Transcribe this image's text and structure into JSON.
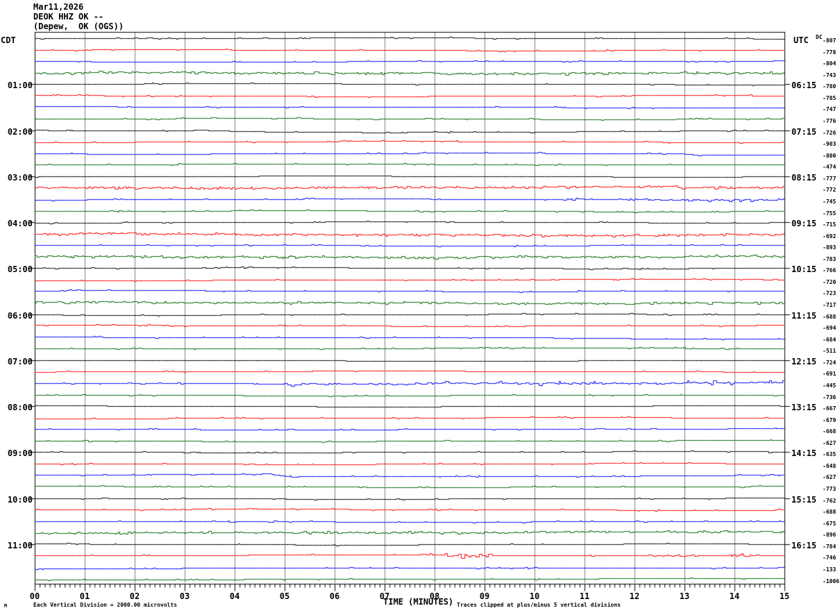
{
  "header": {
    "date": "Mar11,2026",
    "station": "DEOK HHZ OK --",
    "location": "(Depew,  OK (OGS))"
  },
  "axis": {
    "left_header": "CDT",
    "right_header": "UTC",
    "dc_header": "DC",
    "x_title": "TIME (MINUTES)",
    "x_tick_labels": [
      "00",
      "01",
      "02",
      "03",
      "04",
      "05",
      "06",
      "07",
      "08",
      "09",
      "10",
      "11",
      "12",
      "13",
      "14",
      "15"
    ],
    "left_hour_labels": [
      "01:00",
      "02:00",
      "03:00",
      "04:00",
      "05:00",
      "06:00",
      "07:00",
      "08:00",
      "09:00",
      "10:00",
      "11:00"
    ],
    "right_hour_labels": [
      "06:15",
      "07:15",
      "08:15",
      "09:15",
      "10:15",
      "11:15",
      "12:15",
      "13:15",
      "14:15",
      "15:15",
      "16:15"
    ]
  },
  "footer": {
    "scale_note": "Each Vertical Division = 2000.00 microvolts",
    "clip_note": "Traces clipped at plus/minus 5 vertical divisions",
    "corner_mark": "M"
  },
  "colors": {
    "background": "#ffffff",
    "border": "#000000",
    "grid": "#808080",
    "trace_black": "#000000",
    "trace_red": "#ff0000",
    "trace_blue": "#0000ff",
    "trace_green": "#006400"
  },
  "chart_data": {
    "type": "line",
    "variant": "helicorder-seismogram",
    "title": "DEOK HHZ OK -- (Depew, OK (OGS)) Mar11,2026",
    "xlabel": "TIME (MINUTES)",
    "x_range_minutes": [
      0,
      15
    ],
    "rows_count": 48,
    "minutes_per_row": 15,
    "first_row_start_cdt": "00:00",
    "last_row_end_utc": "17:00",
    "row_color_cycle": [
      "#000000",
      "#ff0000",
      "#0000ff",
      "#006400"
    ],
    "hour_label_every_n_rows": 4,
    "grid": "vertical gray line each minute, box border, minor x-ticks every 0.1 minute",
    "dc_offsets": [
      -807,
      -778,
      -804,
      -743,
      -780,
      -785,
      -747,
      -776,
      -726,
      -903,
      -800,
      -474,
      -777,
      -772,
      -745,
      -755,
      -715,
      -692,
      -893,
      -783,
      -766,
      -720,
      -723,
      -717,
      -688,
      -694,
      -684,
      -511,
      -724,
      -691,
      -445,
      -736,
      -667,
      -679,
      -668,
      -627,
      -635,
      -648,
      -627,
      -773,
      -762,
      -688,
      -675,
      -896,
      -784,
      -746,
      -133,
      -1006
    ],
    "scale": "Each Vertical Division = 2000.00 microvolts",
    "clipping": "Traces clipped at plus/minus 5 vertical divisions",
    "notable_features": [
      {
        "row": 8,
        "desc": "slight hump then shallow downward drift, minutes 3-9",
        "drift": [
          [
            0,
            0
          ],
          [
            0.2,
            0
          ],
          [
            0.22,
            -1
          ],
          [
            0.28,
            1
          ],
          [
            0.45,
            2
          ],
          [
            0.7,
            1.5
          ],
          [
            0.95,
            0.5
          ],
          [
            1,
            0.5
          ]
        ]
      },
      {
        "row": 10,
        "desc": "small step down near minute 13",
        "drift": [
          [
            0,
            0
          ],
          [
            0.86,
            0
          ],
          [
            0.88,
            1.5
          ],
          [
            1,
            1.5
          ]
        ]
      },
      {
        "row": 17,
        "desc": "tiny step down near minute 2",
        "drift": [
          [
            0,
            0
          ],
          [
            0.13,
            0
          ],
          [
            0.16,
            1
          ],
          [
            1,
            1
          ]
        ]
      },
      {
        "row": 26,
        "desc": "small step down after minute 11.5",
        "drift": [
          [
            0,
            0
          ],
          [
            0.78,
            0
          ],
          [
            0.8,
            1.5
          ],
          [
            1,
            1.5
          ]
        ]
      },
      {
        "row": 38,
        "desc": "bump then dip near minute 4.5 with slow recovery",
        "drift": [
          [
            0,
            0
          ],
          [
            0.29,
            0
          ],
          [
            0.305,
            -1.5
          ],
          [
            0.34,
            3
          ],
          [
            0.45,
            2.5
          ],
          [
            0.8,
            1
          ],
          [
            1,
            0
          ]
        ]
      },
      {
        "row": 46,
        "desc": "baseline slightly low at start, rising to normal",
        "drift": [
          [
            0,
            2
          ],
          [
            0.55,
            1
          ],
          [
            1,
            0
          ]
        ]
      },
      {
        "row": 14,
        "desc": "elevated noise after minute 10.5",
        "boost": [
          [
            0.7,
            1.0,
            2.0
          ]
        ]
      },
      {
        "row": 30,
        "desc": "elevated noise minutes 5-15",
        "boost": [
          [
            0.33,
            1.0,
            1.9
          ]
        ]
      },
      {
        "row": 45,
        "desc": "noise bursts near minutes 8, 12.5 and 14",
        "boost": [
          [
            0.52,
            0.61,
            2.2
          ],
          [
            0.8,
            0.88,
            2.0
          ],
          [
            0.91,
            0.97,
            2.0
          ]
        ]
      }
    ]
  }
}
